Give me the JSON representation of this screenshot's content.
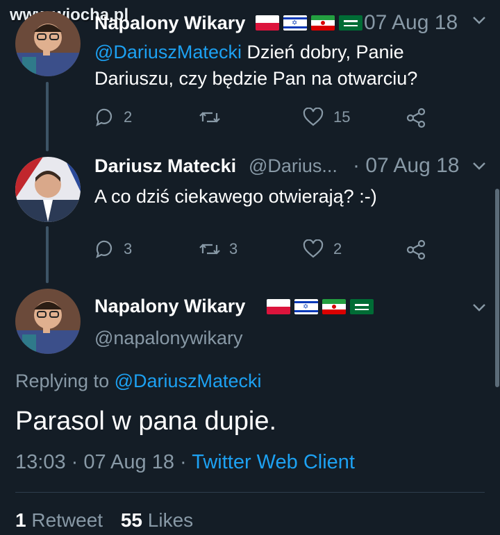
{
  "watermark": "www.wiocha.pl",
  "tweets": [
    {
      "name": "Napalony Wikary",
      "date": "07 Aug 18",
      "mention": "@DariuszMatecki",
      "text": " Dzień dobry, Panie Dariuszu, czy będzie Pan na otwarciu?",
      "replies": "2",
      "retweets": "",
      "likes": "15"
    },
    {
      "name": "Dariusz Matecki",
      "handle": "@Darius...",
      "date": "· 07 Aug 18",
      "text": "A co dziś ciekawego otwierają? :-)",
      "replies": "3",
      "retweets": "3",
      "likes": "2"
    }
  ],
  "main": {
    "name": "Napalony Wikary",
    "handle": "@napalonywikary",
    "replying_prefix": "Replying to ",
    "replying_to": "@DariuszMatecki",
    "text": "Parasol w pana dupie.",
    "timestamp": "13:03 · 07 Aug 18 · ",
    "client": "Twitter Web Client",
    "retweet_count": "1",
    "retweet_label": "Retweet",
    "like_count": "55",
    "like_label": "Likes"
  },
  "flags": [
    "poland-flag",
    "israel-flag",
    "iran-flag",
    "saudi-flag"
  ],
  "colors": {
    "background": "#141d26",
    "link": "#1da1f2",
    "muted": "#8899a6"
  }
}
